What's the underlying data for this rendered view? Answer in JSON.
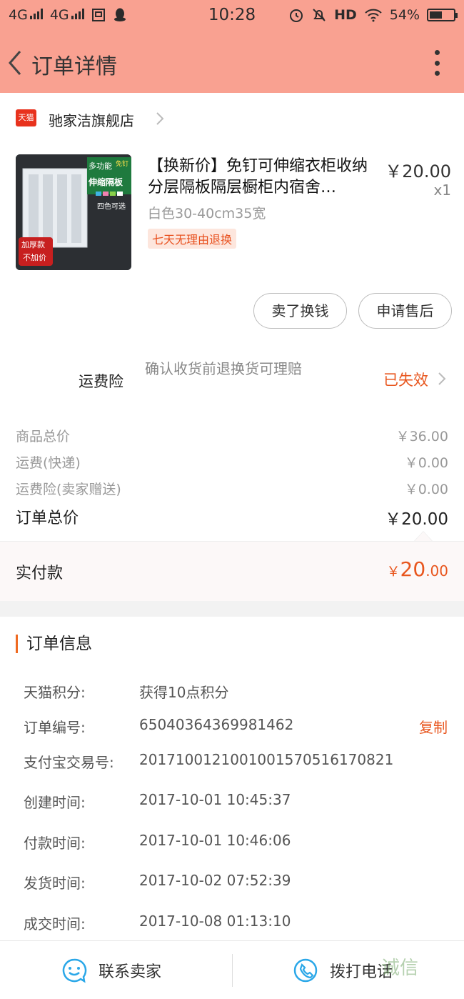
{
  "status_bar": {
    "net1": "4G",
    "net2": "4G",
    "time": "10:28",
    "hd": "HD",
    "battery": "54%",
    "battery_level": 0.54
  },
  "nav": {
    "title": "订单详情"
  },
  "shop": {
    "logo": "天猫",
    "name": "驰家洁旗舰店"
  },
  "product": {
    "title": "【换新价】免钉可伸缩衣柜收纳分层隔板隔层橱柜内宿舍…",
    "price": "￥20.00",
    "qty": "x1",
    "sku": "白色30-40cm35宽",
    "tag": "七天无理由退换",
    "thumb": {
      "badge_top": "多功能",
      "badge_main": "伸缩隔板",
      "corner": "免钉",
      "colors_label": "四色可选",
      "promo1": "加厚款",
      "promo2": "不加价"
    }
  },
  "actions": {
    "sell": "卖了换钱",
    "after_sale": "申请售后"
  },
  "insurance": {
    "label": "运费险",
    "desc": "确认收货前退换货可理赔",
    "status": "已失效"
  },
  "costs": [
    {
      "label": "商品总价",
      "value": "￥36.00"
    },
    {
      "label": "运费(快递)",
      "value": "￥0.00"
    },
    {
      "label": "运费险(卖家赠送)",
      "value": "￥0.00"
    }
  ],
  "order_total": {
    "label": "订单总价",
    "value": "￥20.00"
  },
  "paid": {
    "label": "实付款",
    "symbol": "￥",
    "int": "20",
    "dec": ".00"
  },
  "order_info": {
    "title": "订单信息",
    "copy": "复制",
    "rows": [
      {
        "key": "天猫积分:",
        "value": "获得10点积分"
      },
      {
        "key": "订单编号:",
        "value": "65040364369981462"
      },
      {
        "key": "支付宝交易号:",
        "value": "2017100121001001570516170821"
      },
      {
        "key": "创建时间:",
        "value": "2017-10-01 10:45:37"
      },
      {
        "key": "付款时间:",
        "value": "2017-10-01 10:46:06"
      },
      {
        "key": "发货时间:",
        "value": "2017-10-02 07:52:39"
      },
      {
        "key": "成交时间:",
        "value": "2017-10-08 01:13:10"
      }
    ]
  },
  "bottom": {
    "contact": "联系卖家",
    "call": "拨打电话"
  },
  "watermark": "诚信",
  "colors": {
    "header": "#f9a191",
    "accent": "#e8561e",
    "tmall": "#e8321d",
    "icon_blue": "#2aa7e8"
  }
}
